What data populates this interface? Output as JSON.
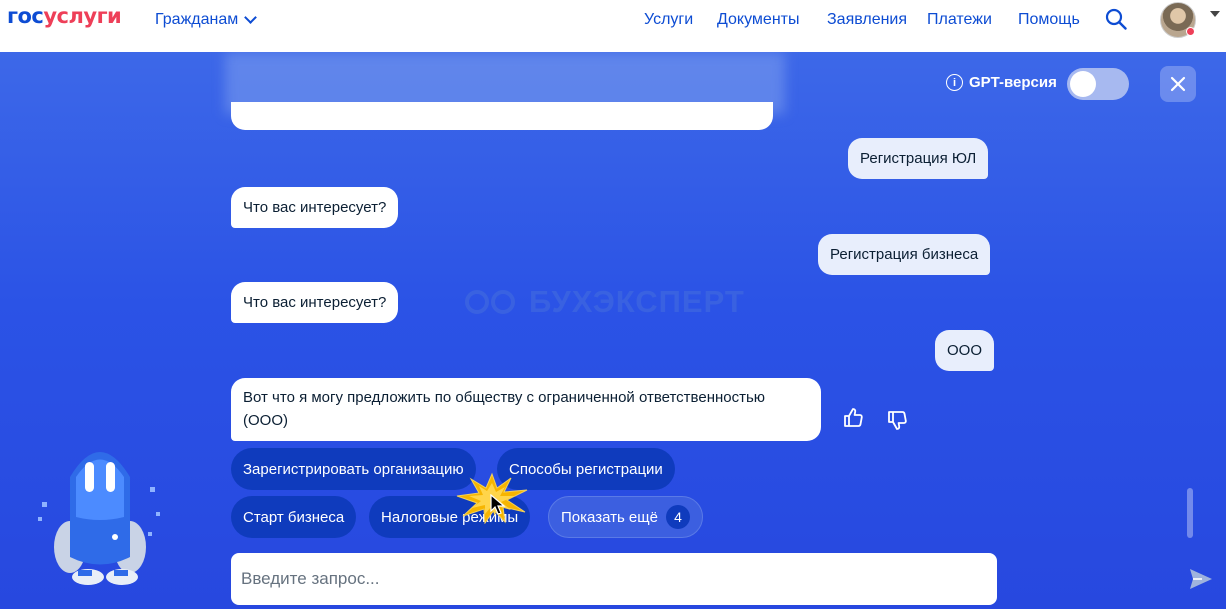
{
  "header": {
    "logo_part1": "гос",
    "logo_part2": "услуги",
    "citizens": "Гражданам",
    "nav": [
      "Услуги",
      "Документы",
      "Заявления",
      "Платежи",
      "Помощь"
    ]
  },
  "chat": {
    "gpt_label": "GPT-версия",
    "gpt_toggle": "off",
    "messages": [
      {
        "from": "user",
        "text": "Регистрация ЮЛ"
      },
      {
        "from": "bot",
        "text": "Что вас интересует?"
      },
      {
        "from": "user",
        "text": "Регистрация бизнеса"
      },
      {
        "from": "bot",
        "text": "Что вас интересует?"
      },
      {
        "from": "user",
        "text": "ООО"
      },
      {
        "from": "bot",
        "text": "Вот что я могу предложить по обществу с ограниченной ответственностью (ООО)"
      }
    ],
    "chips": [
      "Зарегистрировать организацию",
      "Способы регистрации",
      "Старт бизнеса",
      "Налоговые режимы",
      "Показать ещё"
    ],
    "more_count": "4",
    "watermark": "БУХЭКСПЕРТ",
    "input_placeholder": "Введите запрос..."
  },
  "colors": {
    "brand_blue": "#0d4cd3",
    "brand_red": "#ee3f58",
    "chat_bg": "#2b53e6",
    "chip_dark": "#0f3bbd"
  }
}
